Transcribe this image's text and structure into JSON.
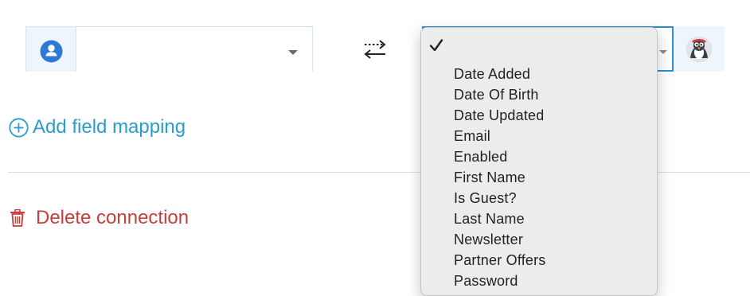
{
  "left_field": {
    "icon": "user-icon",
    "value": ""
  },
  "mapping_icon": "swap-arrows-icon",
  "right_field": {
    "app_icon": "prestashop-logo-icon",
    "dropdown": {
      "selected": "",
      "options": [
        "Date Added",
        "Date Of Birth",
        "Date Updated",
        "Email",
        "Enabled",
        "First Name",
        "Is Guest?",
        "Last Name",
        "Newsletter",
        "Partner Offers",
        "Password"
      ]
    }
  },
  "actions": {
    "add_field_mapping": "Add field mapping",
    "delete_connection": "Delete connection"
  },
  "colors": {
    "link_blue": "#2a9dc8",
    "delete_red": "#c43f3b",
    "focus_blue": "#2a8fd0"
  }
}
